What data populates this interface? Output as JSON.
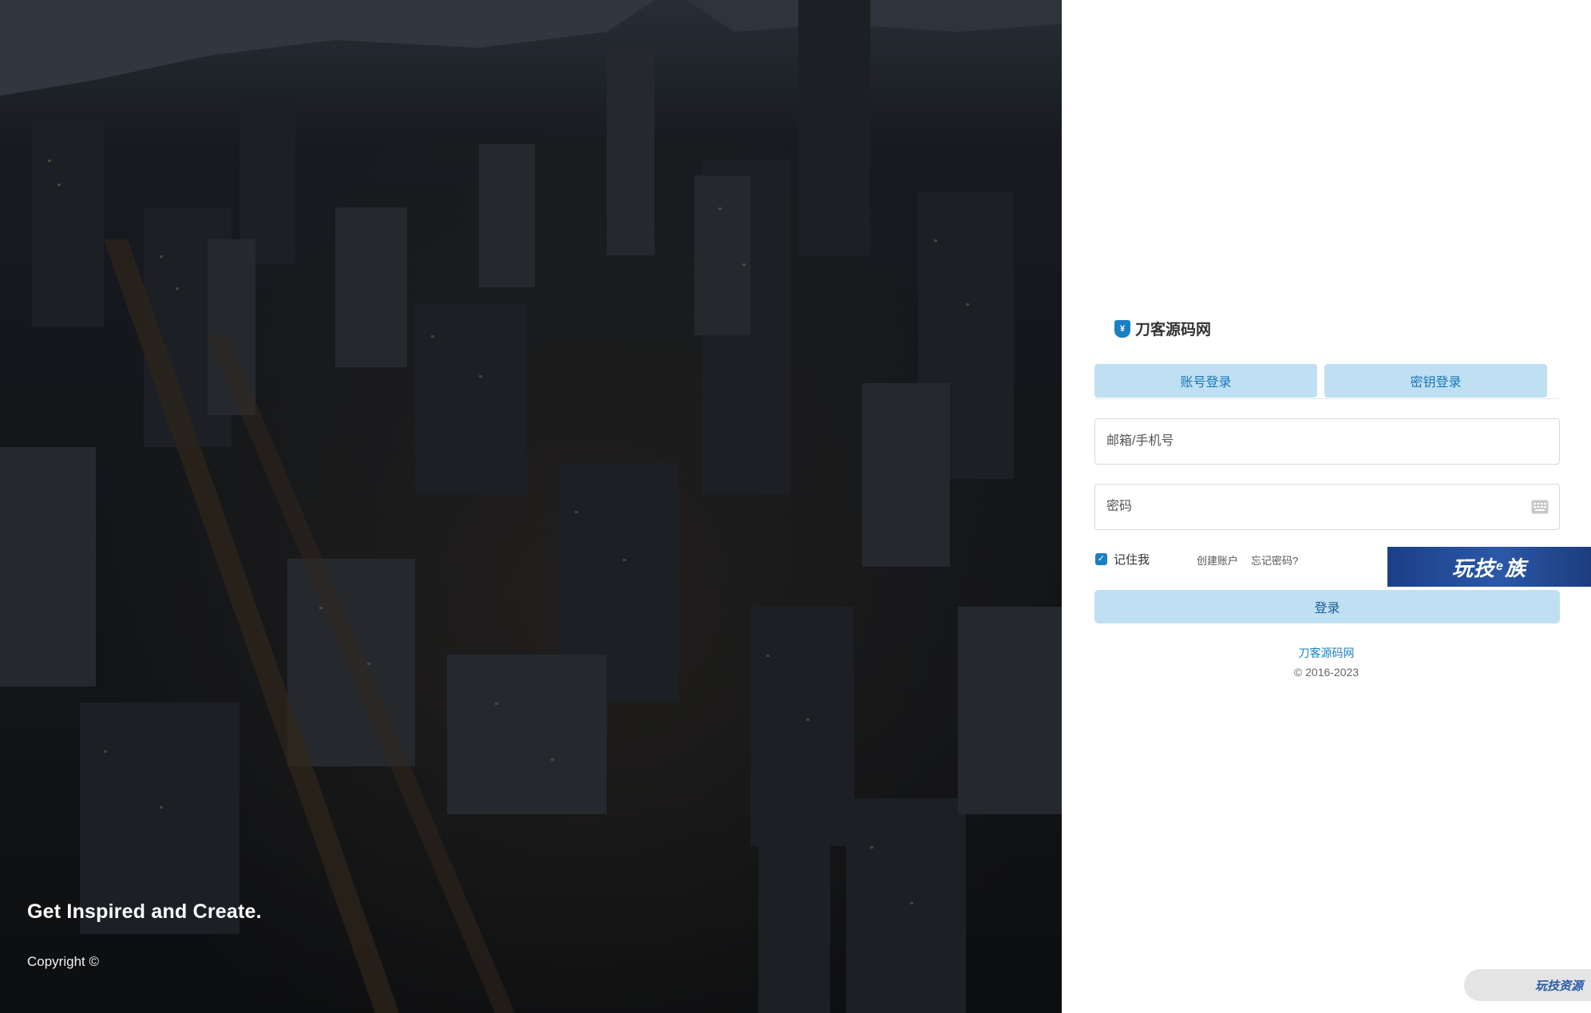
{
  "hero": {
    "tagline": "Get Inspired and Create.",
    "copyright": "Copyright ©"
  },
  "brand": {
    "logo_glyph": "¥",
    "name": "刀客源码网"
  },
  "tabs": [
    {
      "label": "账号登录"
    },
    {
      "label": "密钥登录"
    }
  ],
  "form": {
    "email_placeholder": "邮箱/手机号",
    "password_placeholder": "密码",
    "remember_label": "记住我",
    "remember_checked": true,
    "create_account": "创建账户",
    "forgot_password": "忘记密码?",
    "login_button": "登录"
  },
  "promo": {
    "banner_left": "玩技",
    "banner_e": "e",
    "banner_right": "族",
    "corner_badge": "玩技资源"
  },
  "footer": {
    "site_link": "刀客源码网",
    "copyright": "© 2016-2023"
  },
  "colors": {
    "accent": "#1a7fc4",
    "tab_bg": "#bfe0f2",
    "banner_blue": "#2b58a8"
  }
}
